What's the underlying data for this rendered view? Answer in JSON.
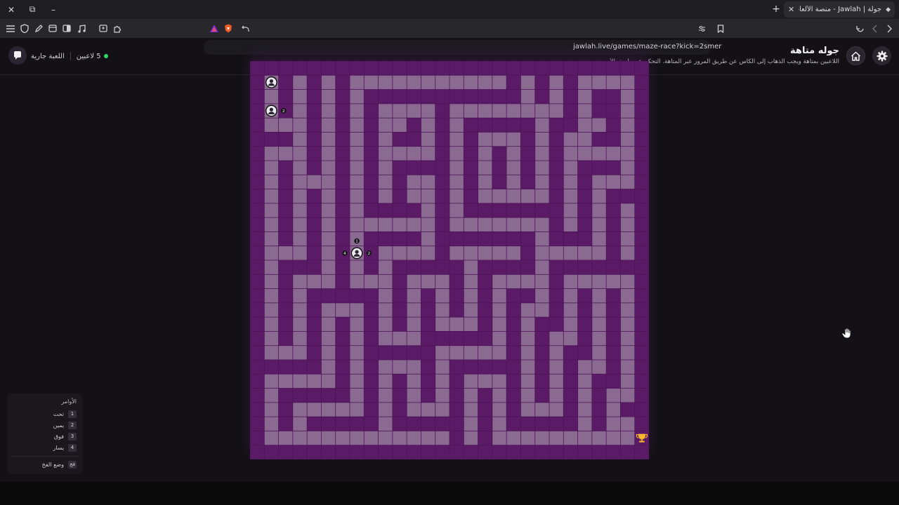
{
  "browser": {
    "tab_title": "جولة | Jawlah - منصة الألعاب التفا",
    "tab_favicon": "jawlah-favicon",
    "url": "jawlah.live/games/maze-race?kick=2smer",
    "icons": [
      "close-icon",
      "restore-icon",
      "minimize-icon",
      "menu-icon",
      "shield-icon",
      "pen-icon",
      "window-icon",
      "sidebar-icon",
      "music-icon",
      "screenshot-icon",
      "extension-icon",
      "brave-rewards-icon",
      "brave-shields-icon",
      "share-icon",
      "bookmark-icon",
      "reload-icon",
      "back-icon",
      "forward-icon"
    ]
  },
  "header": {
    "title": "جوله متاهة",
    "description": "اللاعبين بمتاهة ويجب الذهاب إلى الكأس عن طريق المرور عبر المتاهة. التحكم عن طريق الأ...",
    "players_count": "5 لاعبين",
    "game_status": "اللعبة جارية",
    "colors": {
      "live_dot": "#2fd66a"
    }
  },
  "maze": {
    "rows": 28,
    "cols": 28,
    "colors": {
      "wall": "#5a1a66",
      "path": "#8a6a90",
      "border": "#4c1457"
    },
    "grid": [
      "############################",
      "#.#.#.#...........#.#.#....#",
      "#.#.#.#.###########.#.#.##.#",
      "#.#.#.#.#....#........#.##.#",
      "#...#.#.#..#.#.#####.##..#.#",
      "###.#.#.#.##.#.#...#.#..##.#",
      "#...#.#.#....#.#.#.#.#.....#",
      "#.#.#.#.#.####.#.#.#.#.###.#",
      "#.#...#.#.#..#.#.#.#.#.#...#",
      "#.#.#.#.#.#..#.#.....#.#.###",
      "#.#.#.#.####.#.#######.#.#.#",
      "#.#.#.#......#.......#.#.#.#",
      "#.#.#.#.####.#######.###.#.#",
      "#...#.#.#....#.....#.....#.#",
      "#.###.#.#.#####.####.#######",
      "#.#...#...#...#.#....#.....#",
      "#.#.#####.#.#.#.#.##.#.#.#.#",
      "#.#.#...#.#.#.#.#.#..#.#.#.#",
      "#.#.#.#.#.#.#...#.#.##.#.#.#",
      "#.#.#.#.#...#####.#.#..#.#.#",
      "#...#.#.#####.....#.#.##.#.#",
      "#####.#.#...#.#####.#.#..#.#",
      "#.....#.#.#.#.#...#.#.#.##.#",
      "#.#####.#.#.#.#.#.#.#.#.#..#",
      "#.#.....#.#...#.#.#...#.#.##",
      "#.#.#####.#####.#.#####.#..#",
      "#.............#.#..........#",
      "############################"
    ],
    "players": [
      {
        "row": 1,
        "col": 1,
        "icon": "player-avatar-icon",
        "label": ""
      },
      {
        "row": 3,
        "col": 1,
        "icon": "player-avatar-icon",
        "label": "2"
      },
      {
        "row": 13,
        "col": 7,
        "icon": "player-avatar-icon",
        "label": ""
      }
    ],
    "player_move_hints": [
      "1",
      "4",
      "2"
    ],
    "trophy": {
      "row": 26,
      "col": 27,
      "icon": "trophy-icon"
    }
  },
  "commands": {
    "title": "الأوامر",
    "items": [
      {
        "key": "1",
        "label": "تحت"
      },
      {
        "key": "2",
        "label": "يمين"
      },
      {
        "key": "3",
        "label": "فوق"
      },
      {
        "key": "4",
        "label": "يسار"
      }
    ],
    "trap_key": "فخ",
    "trap_label": "وضع الفخ"
  }
}
